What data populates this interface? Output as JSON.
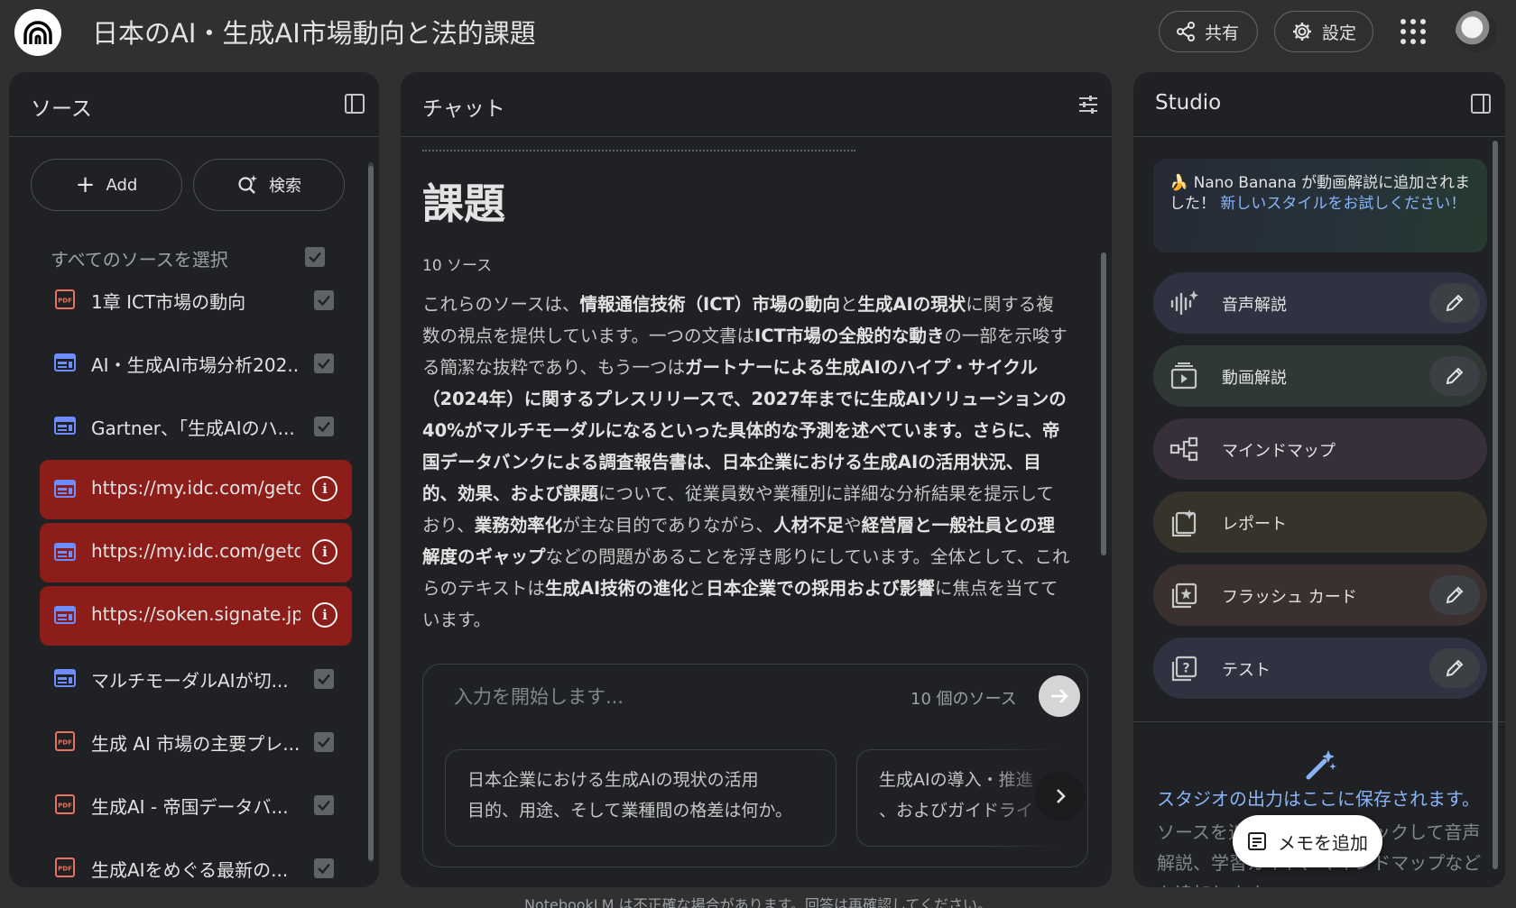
{
  "app": {
    "title": "日本のAI・生成AI市場動向と法的課題",
    "share_label": "共有",
    "settings_label": "設定"
  },
  "sources": {
    "header": "ソース",
    "add_label": "Add",
    "search_label": "検索",
    "select_all_label": "すべてのソースを選択",
    "items": [
      {
        "label": "1章 ICT市場の動向",
        "icon": "pdf-icon",
        "state": "checked"
      },
      {
        "label": "AI・生成AI市場分析202...",
        "icon": "web-icon",
        "state": "checked"
      },
      {
        "label": "Gartner、「生成AIのハ...",
        "icon": "web-icon",
        "state": "checked"
      },
      {
        "label": "https://my.idc.com/getd...",
        "icon": "web-icon",
        "state": "error"
      },
      {
        "label": "https://my.idc.com/getd...",
        "icon": "web-icon",
        "state": "error"
      },
      {
        "label": "https://soken.signate.jp...",
        "icon": "web-icon",
        "state": "error"
      },
      {
        "label": "マルチモーダルAIが切...",
        "icon": "web-icon",
        "state": "checked"
      },
      {
        "label": "生成 AI 市場の主要プレ...",
        "icon": "pdf-icon",
        "state": "checked"
      },
      {
        "label": "生成AI - 帝国データバ...",
        "icon": "pdf-icon",
        "state": "checked"
      },
      {
        "label": "生成AIをめぐる最新の...",
        "icon": "pdf-icon",
        "state": "checked"
      }
    ]
  },
  "chat": {
    "header": "チャット",
    "heading": "課題",
    "source_count": "10 ソース",
    "summary": [
      {
        "t": "これらのソースは、",
        "b": false
      },
      {
        "t": "情報通信技術（ICT）市場の動向",
        "b": true
      },
      {
        "t": "と",
        "b": false
      },
      {
        "t": "生成AIの現状",
        "b": true
      },
      {
        "t": "に関する複数の視点を提供しています。一つの文書は",
        "b": false
      },
      {
        "t": "ICT市場の全般的な動き",
        "b": true
      },
      {
        "t": "の一部を示唆する簡潔な抜粋であり、もう一つは",
        "b": false
      },
      {
        "t": "ガートナーによる生成AIのハイプ・サイクル（2024年）に関するプレスリリースで、2027年までに生成AIソリューションの40%がマルチモーダルになるといった具体的な予測を述べています。さらに、帝国データバンクによる調査報告書は、日本企業における生成AIの活用状況、目的、効果、および課題",
        "b": true
      },
      {
        "t": "について、従業員数や業種別に詳細な分析結果を提示しており、",
        "b": false
      },
      {
        "t": "業務効率化",
        "b": true
      },
      {
        "t": "が主な目的でありながら、",
        "b": false
      },
      {
        "t": "人材不足",
        "b": true
      },
      {
        "t": "や",
        "b": false
      },
      {
        "t": "経営層と一般社員との理解度のギャップ",
        "b": true
      },
      {
        "t": "などの問題があることを浮き彫りにしています。全体として、これらのテキストは",
        "b": false
      },
      {
        "t": "生成AI技術の進化",
        "b": true
      },
      {
        "t": "と",
        "b": false
      },
      {
        "t": "日本企業での採用および影響",
        "b": true
      },
      {
        "t": "に焦点を当てています。",
        "b": false
      }
    ],
    "input_placeholder": "入力を開始します...",
    "input_source_count": "10 個のソース",
    "suggestions": [
      {
        "line1": "日本企業における生成AIの現状の活用",
        "line2": "目的、用途、そして業種間の格差は何か。"
      },
      {
        "line1": "生成AIの導入・推進",
        "line2": "、およびガイドライ"
      }
    ]
  },
  "studio": {
    "header": "Studio",
    "banner_text": "🍌 Nano Banana が動画解説に追加されました！",
    "banner_link": "新しいスタイルをお試しください！",
    "cards": [
      {
        "label": "音声解説",
        "icon": "audio-overview-icon",
        "color": "#2f3341",
        "editable": true
      },
      {
        "label": "動画解説",
        "icon": "video-overview-icon",
        "color": "#2f3834",
        "editable": true
      },
      {
        "label": "マインドマップ",
        "icon": "mind-map-icon",
        "color": "#372f3a",
        "editable": false
      },
      {
        "label": "レポート",
        "icon": "report-icon",
        "color": "#36342a",
        "editable": false
      },
      {
        "label": "フラッシュ カード",
        "icon": "flashcards-icon",
        "color": "#3a302f",
        "editable": true
      },
      {
        "label": "テスト",
        "icon": "quiz-icon",
        "color": "#2f3341",
        "editable": true
      }
    ],
    "empty_title": "スタジオの出力はここに保存されます。",
    "empty_desc": "ソースを追加した後、クリックして音声解説、学習ガイド、マインドマップなどを追加します。",
    "add_note_label": "メモを追加"
  },
  "footer": {
    "disclaimer": "NotebookLM は不正確な場合があります。回答は再確認してください。"
  }
}
